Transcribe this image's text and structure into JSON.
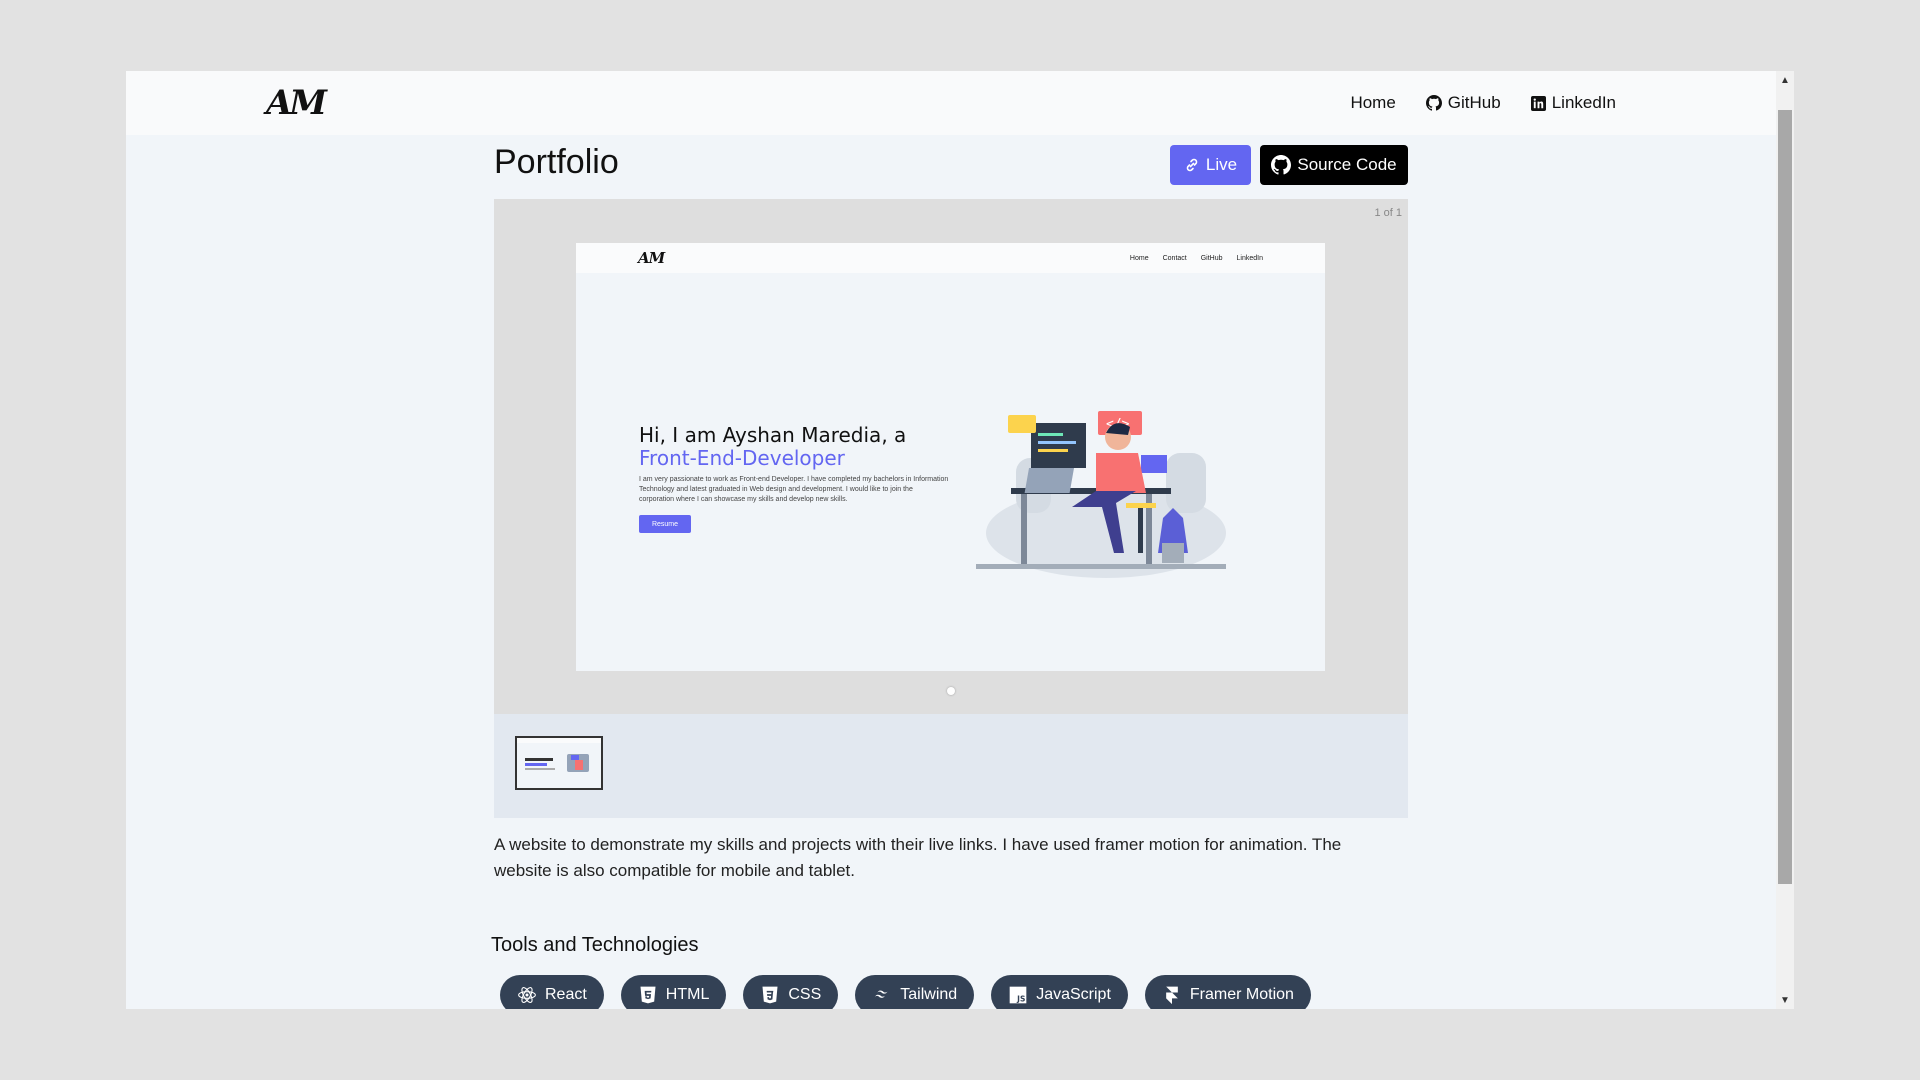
{
  "header": {
    "logo": "AM",
    "nav": [
      {
        "label": "Home",
        "icon": "none"
      },
      {
        "label": "GitHub",
        "icon": "github-icon"
      },
      {
        "label": "LinkedIn",
        "icon": "linkedin-icon"
      }
    ]
  },
  "project": {
    "title": "Portfolio",
    "live_label": "Live",
    "source_label": "Source Code",
    "accent": "#6366f1"
  },
  "gallery": {
    "counter": "1 of 1",
    "preview": {
      "logo": "AM",
      "nav": [
        "Home",
        "Contact",
        "GitHub",
        "LinkedIn"
      ],
      "headline_line1": "Hi, I am Ayshan Maredia, a",
      "headline_line2": "Front-End-Developer",
      "paragraph": "I am very passionate to work as Front-end Developer. I have completed my bachelors in Information Technology and latest graduated in Web design and development. I would like to join the corporation where I can showcase my skills and develop new skills.",
      "resume_label": "Resume"
    }
  },
  "description": "A website to demonstrate my skills and projects with their live links. I have used framer motion for animation. The website is also compatible for mobile and tablet.",
  "tools": {
    "title": "Tools and Technologies",
    "items": [
      {
        "label": "React",
        "icon": "react-icon"
      },
      {
        "label": "HTML",
        "icon": "html5-icon"
      },
      {
        "label": "CSS",
        "icon": "css3-icon"
      },
      {
        "label": "Tailwind",
        "icon": "tailwind-icon"
      },
      {
        "label": "JavaScript",
        "icon": "javascript-icon"
      },
      {
        "label": "Framer Motion",
        "icon": "framer-icon"
      }
    ]
  }
}
